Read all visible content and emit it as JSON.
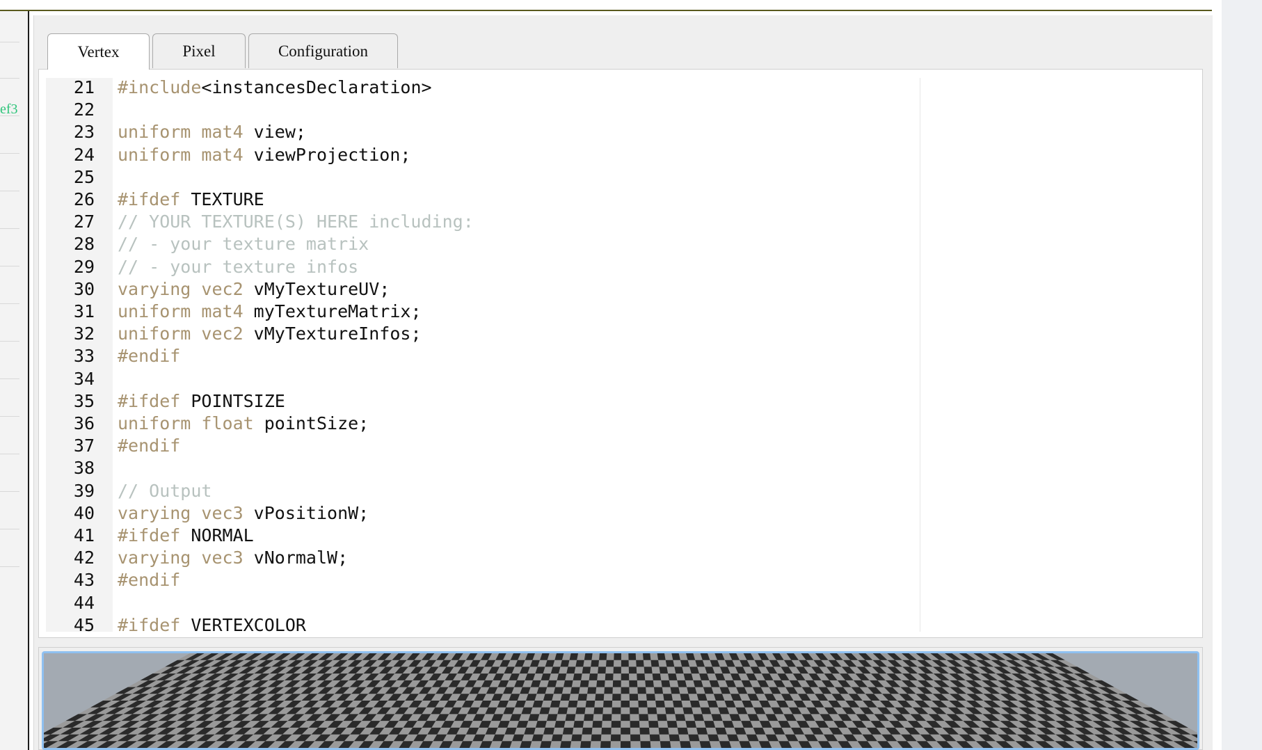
{
  "sidebar": {
    "visible_label": "ef3",
    "label_color": "#2ec47a"
  },
  "tabs": [
    {
      "label": "Vertex",
      "active": true
    },
    {
      "label": "Pixel",
      "active": false
    },
    {
      "label": "Configuration",
      "active": false
    }
  ],
  "editor": {
    "colors": {
      "keyword": "#a79370",
      "comment": "#b8c2bf",
      "text": "#111111",
      "gutter": "#f3f3f3"
    },
    "lines": [
      {
        "n": "21",
        "tokens": [
          [
            "kw",
            "#include"
          ],
          [
            "tx",
            "<instancesDeclaration>"
          ]
        ]
      },
      {
        "n": "22",
        "tokens": []
      },
      {
        "n": "23",
        "tokens": [
          [
            "kw",
            "uniform mat4 "
          ],
          [
            "tx",
            "view;"
          ]
        ]
      },
      {
        "n": "24",
        "tokens": [
          [
            "kw",
            "uniform mat4 "
          ],
          [
            "tx",
            "viewProjection;"
          ]
        ]
      },
      {
        "n": "25",
        "tokens": []
      },
      {
        "n": "26",
        "tokens": [
          [
            "kw",
            "#ifdef "
          ],
          [
            "tx",
            "TEXTURE"
          ]
        ]
      },
      {
        "n": "27",
        "tokens": [
          [
            "cm",
            "// YOUR TEXTURE(S) HERE including:"
          ]
        ]
      },
      {
        "n": "28",
        "tokens": [
          [
            "cm",
            "// - your texture matrix"
          ]
        ]
      },
      {
        "n": "29",
        "tokens": [
          [
            "cm",
            "// - your texture infos"
          ]
        ]
      },
      {
        "n": "30",
        "tokens": [
          [
            "kw",
            "varying vec2 "
          ],
          [
            "tx",
            "vMyTextureUV;"
          ]
        ]
      },
      {
        "n": "31",
        "tokens": [
          [
            "kw",
            "uniform mat4 "
          ],
          [
            "tx",
            "myTextureMatrix;"
          ]
        ]
      },
      {
        "n": "32",
        "tokens": [
          [
            "kw",
            "uniform vec2 "
          ],
          [
            "tx",
            "vMyTextureInfos;"
          ]
        ]
      },
      {
        "n": "33",
        "tokens": [
          [
            "kw",
            "#endif"
          ]
        ]
      },
      {
        "n": "34",
        "tokens": []
      },
      {
        "n": "35",
        "tokens": [
          [
            "kw",
            "#ifdef "
          ],
          [
            "tx",
            "POINTSIZE"
          ]
        ]
      },
      {
        "n": "36",
        "tokens": [
          [
            "kw",
            "uniform float "
          ],
          [
            "tx",
            "pointSize;"
          ]
        ]
      },
      {
        "n": "37",
        "tokens": [
          [
            "kw",
            "#endif"
          ]
        ]
      },
      {
        "n": "38",
        "tokens": []
      },
      {
        "n": "39",
        "tokens": [
          [
            "cm",
            "// Output"
          ]
        ]
      },
      {
        "n": "40",
        "tokens": [
          [
            "kw",
            "varying vec3 "
          ],
          [
            "tx",
            "vPositionW;"
          ]
        ]
      },
      {
        "n": "41",
        "tokens": [
          [
            "kw",
            "#ifdef "
          ],
          [
            "tx",
            "NORMAL"
          ]
        ]
      },
      {
        "n": "42",
        "tokens": [
          [
            "kw",
            "varying vec3 "
          ],
          [
            "tx",
            "vNormalW;"
          ]
        ]
      },
      {
        "n": "43",
        "tokens": [
          [
            "kw",
            "#endif"
          ]
        ]
      },
      {
        "n": "44",
        "tokens": []
      },
      {
        "n": "45",
        "tokens": [
          [
            "kw",
            "#ifdef "
          ],
          [
            "tx",
            "VERTEXCOLOR"
          ]
        ]
      }
    ]
  },
  "preview": {
    "sky_color": "#a3aab2",
    "checker_dark": "#2a2a2a",
    "checker_light": "#9a9a9a"
  }
}
